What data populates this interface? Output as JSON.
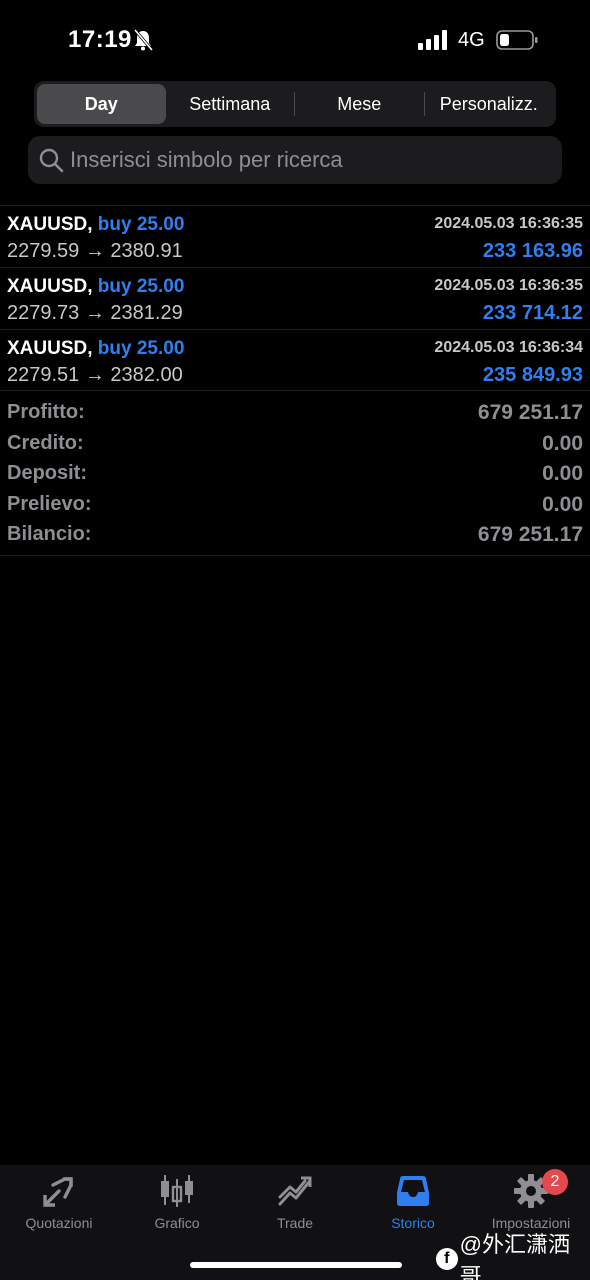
{
  "status_bar": {
    "time": "17:19",
    "network": "4G"
  },
  "segments": [
    "Day",
    "Settimana",
    "Mese",
    "Personalizz."
  ],
  "active_segment": "Day",
  "search": {
    "placeholder": "Inserisci simbolo per ricerca"
  },
  "trades": [
    {
      "symbol": "XAUUSD,",
      "side": "buy 25.00",
      "prices": "2279.59 → 2380.91",
      "datetime": "2024.05.03 16:36:35",
      "profit": "233 163.96"
    },
    {
      "symbol": "XAUUSD,",
      "side": "buy 25.00",
      "prices": "2279.73 → 2381.29",
      "datetime": "2024.05.03 16:36:35",
      "profit": "233 714.12"
    },
    {
      "symbol": "XAUUSD,",
      "side": "buy 25.00",
      "prices": "2279.51 → 2382.00",
      "datetime": "2024.05.03 16:36:34",
      "profit": "235 849.93"
    }
  ],
  "summary": [
    {
      "label": "Profitto:",
      "value": "679 251.17"
    },
    {
      "label": "Credito:",
      "value": "0.00"
    },
    {
      "label": "Deposit:",
      "value": "0.00"
    },
    {
      "label": "Prelievo:",
      "value": "0.00"
    },
    {
      "label": "Bilancio:",
      "value": "679 251.17"
    }
  ],
  "tabs": [
    {
      "label": "Quotazioni",
      "icon": "quotes-arrows-icon"
    },
    {
      "label": "Grafico",
      "icon": "candlestick-chart-icon"
    },
    {
      "label": "Trade",
      "icon": "trade-trend-icon"
    },
    {
      "label": "Storico",
      "icon": "history-inbox-icon"
    },
    {
      "label": "Impostazioni",
      "icon": "settings-gear-icon",
      "badge": "2"
    }
  ],
  "active_tab": "Storico",
  "watermark": "@外汇潇洒哥",
  "colors": {
    "accent": "#2f7ff0",
    "background": "#000000",
    "muted": "#8e8e93",
    "badge": "#e5484d"
  }
}
